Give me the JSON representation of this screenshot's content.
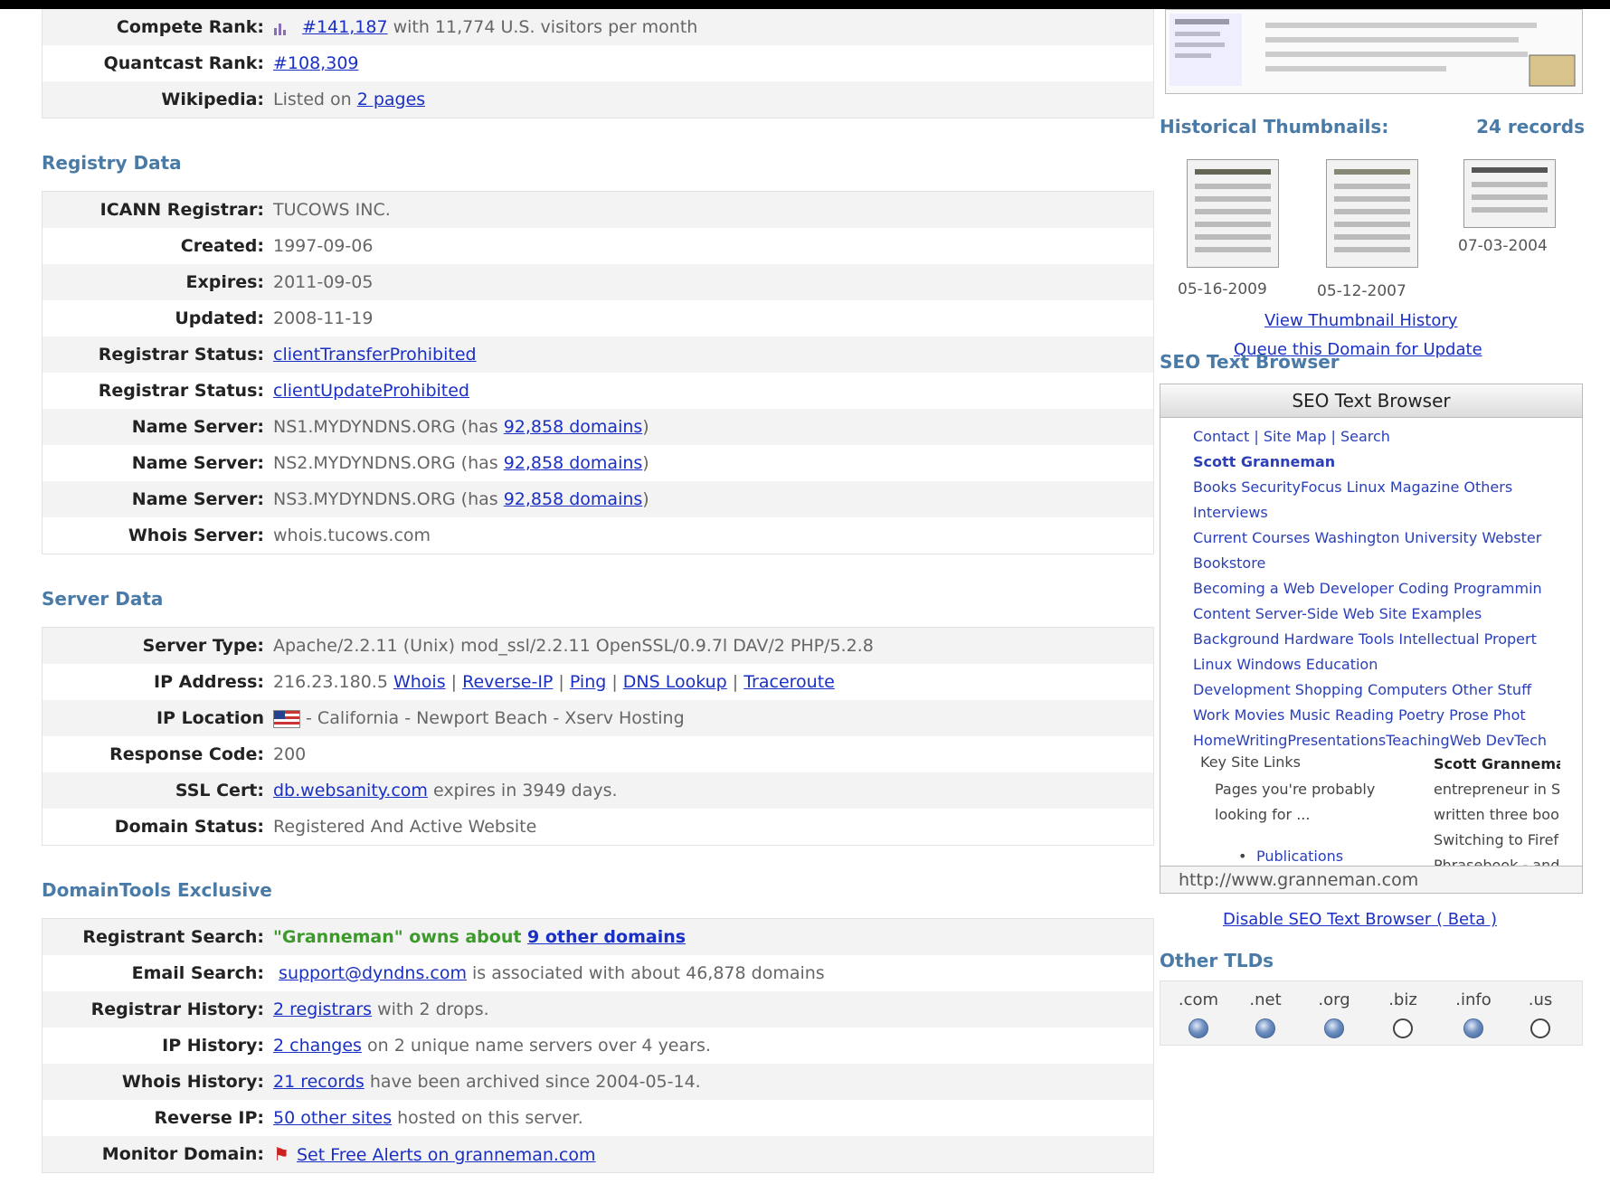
{
  "top": {
    "rows": [
      {
        "key": "Compete Rank:",
        "link": "#141,187",
        "rest": " with 11,774 U.S. visitors per month"
      },
      {
        "key": "Quantcast Rank:",
        "link": "#108,309",
        "rest": ""
      },
      {
        "key": "Wikipedia:",
        "pre": "Listed on ",
        "link": "2 pages",
        "rest": ""
      }
    ]
  },
  "registry": {
    "title": "Registry Data",
    "rows": [
      {
        "key": "ICANN Registrar:",
        "value": "TUCOWS INC."
      },
      {
        "key": "Created:",
        "value": "1997-09-06"
      },
      {
        "key": "Expires:",
        "value": "2011-09-05"
      },
      {
        "key": "Updated:",
        "value": "2008-11-19"
      },
      {
        "key": "Registrar Status:",
        "link": "clientTransferProhibited"
      },
      {
        "key": "Registrar Status:",
        "link": "clientUpdateProhibited"
      },
      {
        "key": "Name Server:",
        "value": "NS1.MYDYNDNS.ORG (has ",
        "link": "92,858 domains",
        "after": ")"
      },
      {
        "key": "Name Server:",
        "value": "NS2.MYDYNDNS.ORG (has ",
        "link": "92,858 domains",
        "after": ")"
      },
      {
        "key": "Name Server:",
        "value": "NS3.MYDYNDNS.ORG (has ",
        "link": "92,858 domains",
        "after": ")"
      },
      {
        "key": "Whois Server:",
        "value": "whois.tucows.com"
      }
    ]
  },
  "server": {
    "title": "Server Data",
    "server_type": {
      "key": "Server Type:",
      "value": "Apache/2.2.11 (Unix) mod_ssl/2.2.11 OpenSSL/0.9.7l DAV/2 PHP/5.2.8"
    },
    "ip": {
      "key": "IP Address:",
      "value": "216.23.180.5",
      "links": [
        "Whois",
        "Reverse-IP",
        "Ping",
        "DNS Lookup",
        "Traceroute"
      ]
    },
    "location": {
      "key": "IP Location",
      "value": " - California - Newport Beach - Xserv Hosting"
    },
    "response": {
      "key": "Response Code:",
      "value": "200"
    },
    "ssl": {
      "key": "SSL Cert:",
      "link": "db.websanity.com",
      "rest": " expires in 3949 days."
    },
    "status": {
      "key": "Domain Status:",
      "value": "Registered And Active Website"
    }
  },
  "exclusive": {
    "title": "DomainTools Exclusive",
    "registrant": {
      "key": "Registrant Search:",
      "green": "\"Granneman\" owns about ",
      "link": "9 other domains"
    },
    "email": {
      "key": "Email Search:",
      "link": "support@dyndns.com",
      "rest": " is associated with about 46,878 domains"
    },
    "reg_history": {
      "key": "Registrar History:",
      "link": "2 registrars",
      "rest": " with 2 drops."
    },
    "ip_history": {
      "key": "IP History:",
      "link": "2 changes",
      "rest": " on 2 unique name servers over 4 years."
    },
    "whois_history": {
      "key": "Whois History:",
      "link": "21 records",
      "rest": " have been archived since 2004-05-14."
    },
    "reverse_ip": {
      "key": "Reverse IP:",
      "link": "50 other sites",
      "rest": " hosted on this server."
    },
    "monitor": {
      "key": "Monitor Domain:",
      "link": "Set Free Alerts on granneman.com"
    }
  },
  "right": {
    "hist_title": "Historical Thumbnails:",
    "hist_count": "24 records",
    "thumb_dates": [
      "05-16-2009",
      "05-12-2007",
      "07-03-2004"
    ],
    "view_history": "View Thumbnail History",
    "queue": "Queue this Domain for Update",
    "seo_title": "SEO Text Browser",
    "seo_box_title": "SEO Text Browser",
    "seo_lines": [
      "Contact | Site Map | Search",
      "Scott Granneman",
      "Books SecurityFocus Linux Magazine Others",
      "Interviews",
      "Current Courses Washington University Webster",
      "Bookstore",
      "Becoming a Web Developer Coding Programmin",
      "Content Server-Side Web Site Examples",
      "Background Hardware Tools Intellectual Propert",
      "Linux Windows Education",
      "Development Shopping Computers Other Stuff",
      "Work Movies Music Reading Poetry Prose Phot",
      "HomeWritingPresentationsTeachingWeb DevTech"
    ],
    "seo_grid": {
      "key_links": "Key Site Links",
      "pages1": "Pages you're probably",
      "pages2": "looking for ...",
      "publications": "Publications",
      "sg1": "Scott Granneman",
      "sg2": "entrepreneur in S",
      "sg3": "written three boo",
      "sg4": "Switching to Firef",
      "sg5": "Phrasebook - and"
    },
    "seo_url": "http://www.granneman.com",
    "disable": "Disable SEO Text Browser ( Beta )",
    "tlds_title": "Other TLDs",
    "tlds": [
      {
        "label": ".com",
        "state": "on"
      },
      {
        "label": ".net",
        "state": "on"
      },
      {
        "label": ".org",
        "state": "on"
      },
      {
        "label": ".biz",
        "state": "off"
      },
      {
        "label": ".info",
        "state": "on"
      },
      {
        "label": ".us",
        "state": "off"
      }
    ]
  }
}
